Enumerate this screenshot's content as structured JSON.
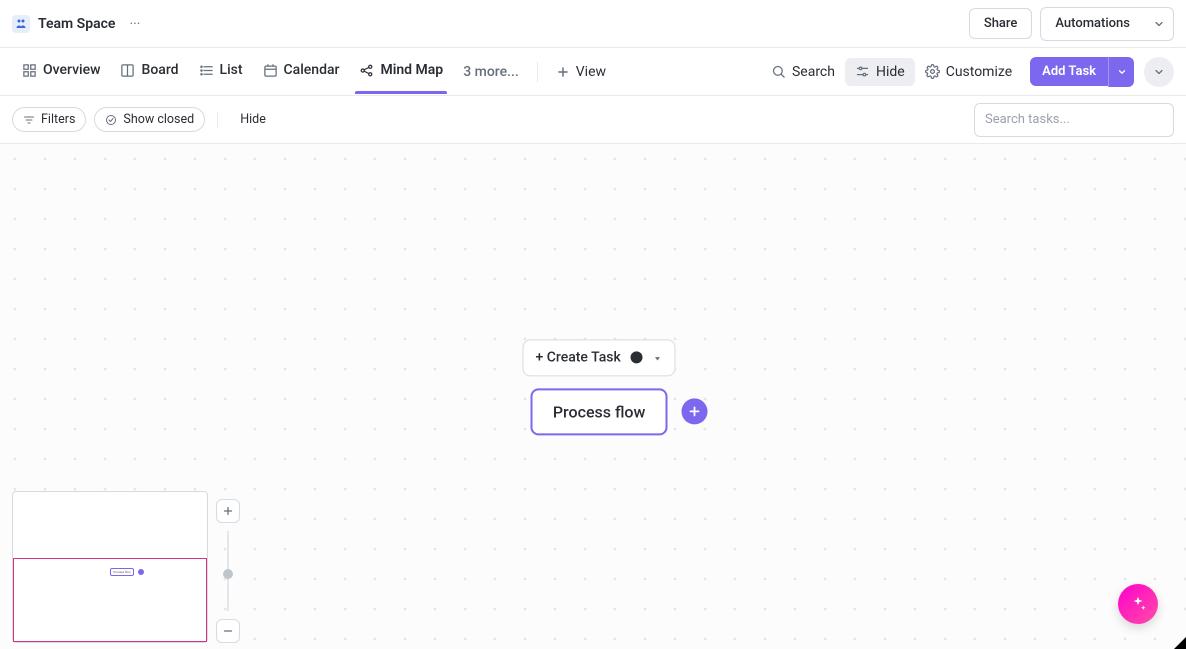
{
  "header": {
    "title": "Team Space",
    "share_label": "Share",
    "automations_label": "Automations"
  },
  "views": {
    "tabs": [
      {
        "label": "Overview",
        "icon": "grid-icon"
      },
      {
        "label": "Board",
        "icon": "board-icon"
      },
      {
        "label": "List",
        "icon": "list-icon"
      },
      {
        "label": "Calendar",
        "icon": "calendar-icon"
      },
      {
        "label": "Mind Map",
        "icon": "mindmap-icon",
        "active": true
      }
    ],
    "more_label": "3 more...",
    "add_view_label": "View",
    "search_label": "Search",
    "hide_label": "Hide",
    "customize_label": "Customize",
    "add_task_label": "Add Task"
  },
  "filters": {
    "filters_label": "Filters",
    "show_closed_label": "Show closed",
    "hide_label": "Hide",
    "search_placeholder": "Search tasks..."
  },
  "canvas": {
    "create_task_label": "+ Create Task",
    "root_node_label": "Process flow"
  },
  "colors": {
    "accent": "#7b68ee",
    "fab": "#ff00cc"
  }
}
